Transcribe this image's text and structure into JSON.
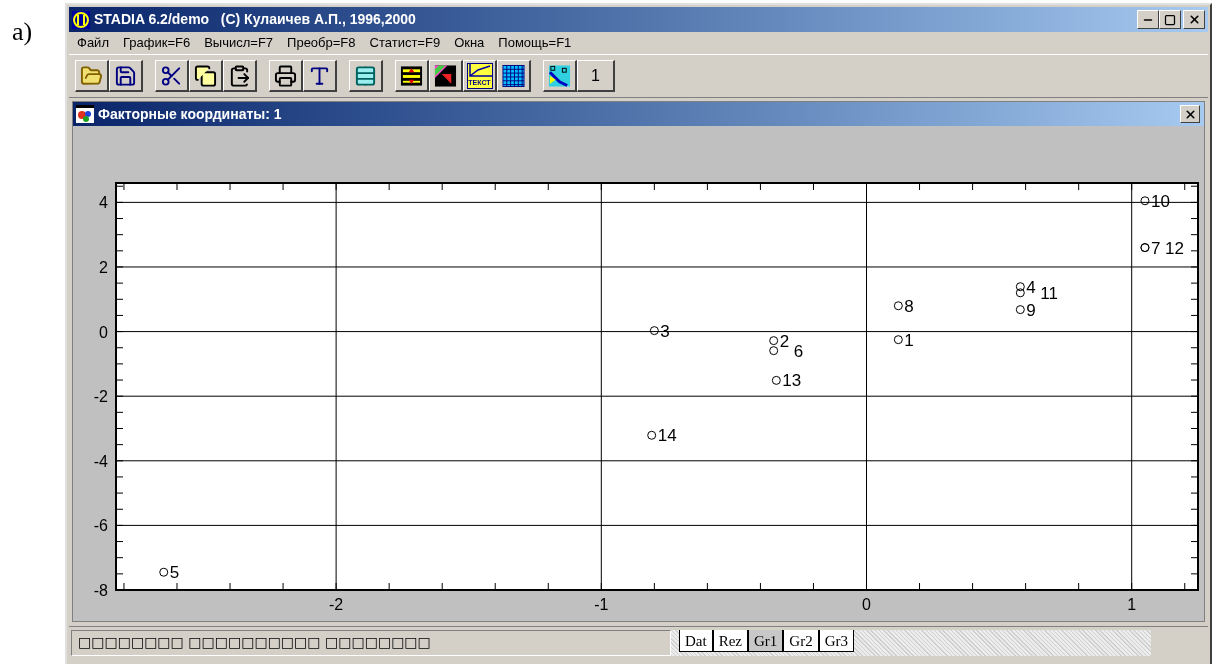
{
  "figure_label": "a)",
  "window": {
    "title": "STADIA 6.2/demo   (C) Кулаичев А.П., 1996,2000"
  },
  "menu": [
    "Файл",
    "График=F6",
    "Вычисл=F7",
    "Преобр=F8",
    "Статист=F9",
    "Окна",
    "Помощь=F1"
  ],
  "toolbar": [
    [
      {
        "kind": "open"
      },
      {
        "kind": "save"
      }
    ],
    [
      {
        "kind": "cut"
      },
      {
        "kind": "copy"
      },
      {
        "kind": "paste"
      }
    ],
    [
      {
        "kind": "print"
      },
      {
        "kind": "fonts"
      }
    ],
    [
      {
        "kind": "wizard"
      }
    ],
    [
      {
        "kind": "layers"
      },
      {
        "kind": "colors"
      },
      {
        "kind": "text-chart",
        "text": "ТЕКСТ"
      },
      {
        "kind": "grid"
      }
    ],
    [
      {
        "kind": "scatter"
      },
      {
        "kind": "label",
        "text": "1"
      }
    ]
  ],
  "child_window": {
    "title": "Факторные координаты: 1",
    "chart_data": {
      "type": "scatter",
      "grid": true,
      "xlim": [
        -2.83,
        1.25
      ],
      "ylim": [
        -8,
        4.6
      ],
      "xticks": [
        -2,
        -1,
        0,
        1
      ],
      "yticks": [
        4,
        2,
        0,
        -2,
        -4,
        -6,
        -8
      ],
      "x": [
        0.12,
        -0.35,
        -0.8,
        0.58,
        -2.65,
        -0.35,
        1.05,
        0.12,
        0.58,
        1.05,
        0.58,
        1.05,
        -0.34,
        -0.81
      ],
      "series": [
        {
          "color": "#000000",
          "values": [
            -0.25,
            -0.28,
            0.03,
            1.39,
            -7.45,
            -0.59,
            2.6,
            0.8,
            0.68,
            4.05,
            1.2,
            2.6,
            -1.51,
            -3.21
          ]
        }
      ],
      "annotations": [
        {
          "text": "1",
          "x": 0.12,
          "y": -0.25
        },
        {
          "text": "2",
          "x": -0.35,
          "y": -0.28
        },
        {
          "text": "3",
          "x": -0.8,
          "y": 0.03
        },
        {
          "text": "4",
          "x": 0.58,
          "y": 1.39
        },
        {
          "text": "5",
          "x": -2.65,
          "y": -7.45
        },
        {
          "text": "6",
          "x": -0.35,
          "y": -0.59
        },
        {
          "text": "7",
          "x": 1.05,
          "y": 2.6
        },
        {
          "text": "8",
          "x": 0.12,
          "y": 0.8
        },
        {
          "text": "9",
          "x": 0.58,
          "y": 0.68
        },
        {
          "text": "10",
          "x": 1.05,
          "y": 4.05
        },
        {
          "text": "11",
          "x": 0.58,
          "y": 1.2
        },
        {
          "text": "12",
          "x": 1.05,
          "y": 2.6
        },
        {
          "text": "13",
          "x": -0.34,
          "y": -1.51
        },
        {
          "text": "14",
          "x": -0.81,
          "y": -3.21
        }
      ]
    }
  },
  "status_bar": {
    "text": "□□□□□□□□ □□□□□□□□□□ □□□□□□□□",
    "tabs": [
      {
        "label": "Dat",
        "selected": false
      },
      {
        "label": "Rez",
        "selected": false
      },
      {
        "label": "Gr1",
        "selected": true
      },
      {
        "label": "Gr2",
        "selected": false
      },
      {
        "label": "Gr3",
        "selected": false
      }
    ]
  }
}
